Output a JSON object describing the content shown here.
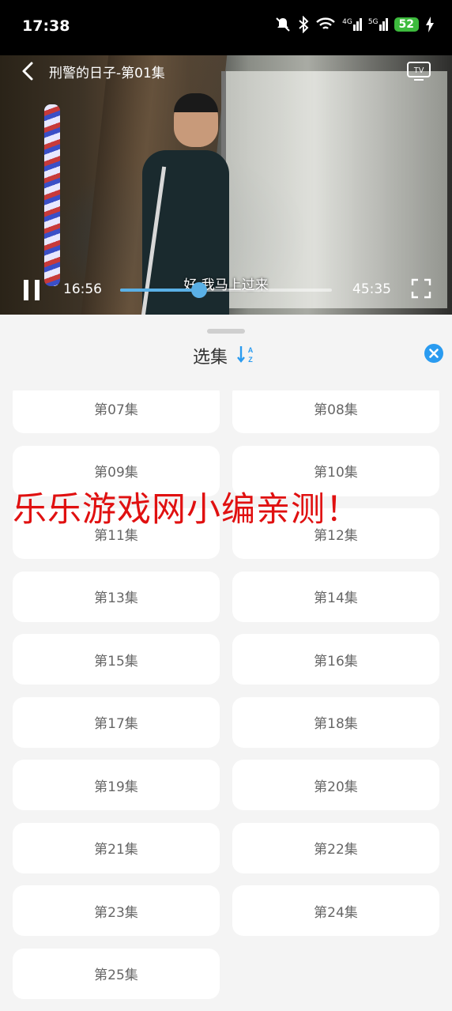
{
  "status_bar": {
    "time": "17:38",
    "signal_4g": "4G",
    "signal_5g": "5G",
    "battery": "52"
  },
  "player": {
    "title": "刑警的日子-第01集",
    "subtitle": "好,我马上过来",
    "current_time": "16:56",
    "total_time": "45:35",
    "progress": 0.372,
    "cast_icon": "tv-icon",
    "accent_color": "#5ab0e6"
  },
  "episode_panel": {
    "title": "选集",
    "sort_icon": "sort-az-icon",
    "close_icon": "close-icon",
    "close_color": "#2a9bf0",
    "episodes": [
      "第07集",
      "第08集",
      "第09集",
      "第10集",
      "第11集",
      "第12集",
      "第13集",
      "第14集",
      "第15集",
      "第16集",
      "第17集",
      "第18集",
      "第19集",
      "第20集",
      "第21集",
      "第22集",
      "第23集",
      "第24集",
      "第25集"
    ]
  },
  "watermark": "乐乐游戏网小编亲测！"
}
